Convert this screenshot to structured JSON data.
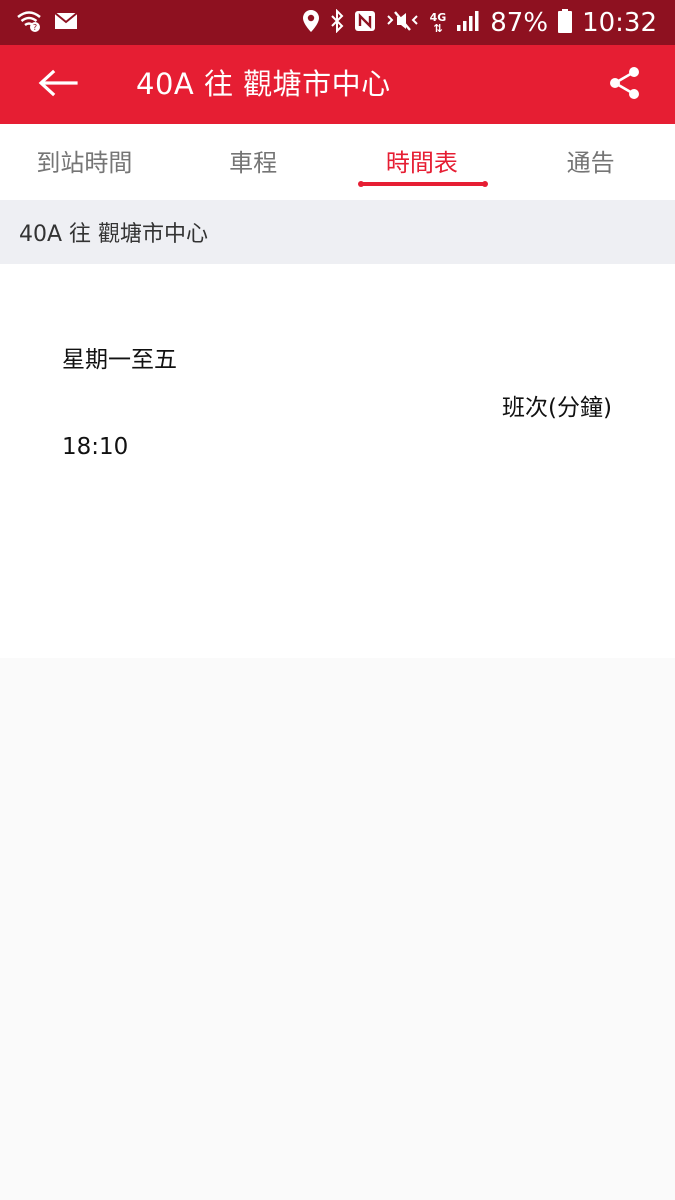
{
  "status_bar": {
    "battery": "87%",
    "time": "10:32",
    "network": "4G",
    "icons": [
      "wifi-call-icon",
      "mail-icon",
      "location-icon",
      "bluetooth-icon",
      "nfc-icon",
      "mute-icon",
      "network-4g-icon",
      "signal-icon",
      "battery-icon"
    ]
  },
  "app_bar": {
    "title": "40A 往 觀塘市中心",
    "back_icon": "arrow-left-icon",
    "share_icon": "share-icon",
    "color": "#e61e33"
  },
  "tabs": [
    {
      "label": "到站時間",
      "active": false
    },
    {
      "label": "車程",
      "active": false
    },
    {
      "label": "時間表",
      "active": true
    },
    {
      "label": "通告",
      "active": false
    }
  ],
  "route_header": "40A 往 觀塘市中心",
  "timetable": {
    "day": "星期一至五",
    "frequency_header": "班次(分鐘)",
    "rows": [
      {
        "time": "18:10"
      }
    ]
  }
}
